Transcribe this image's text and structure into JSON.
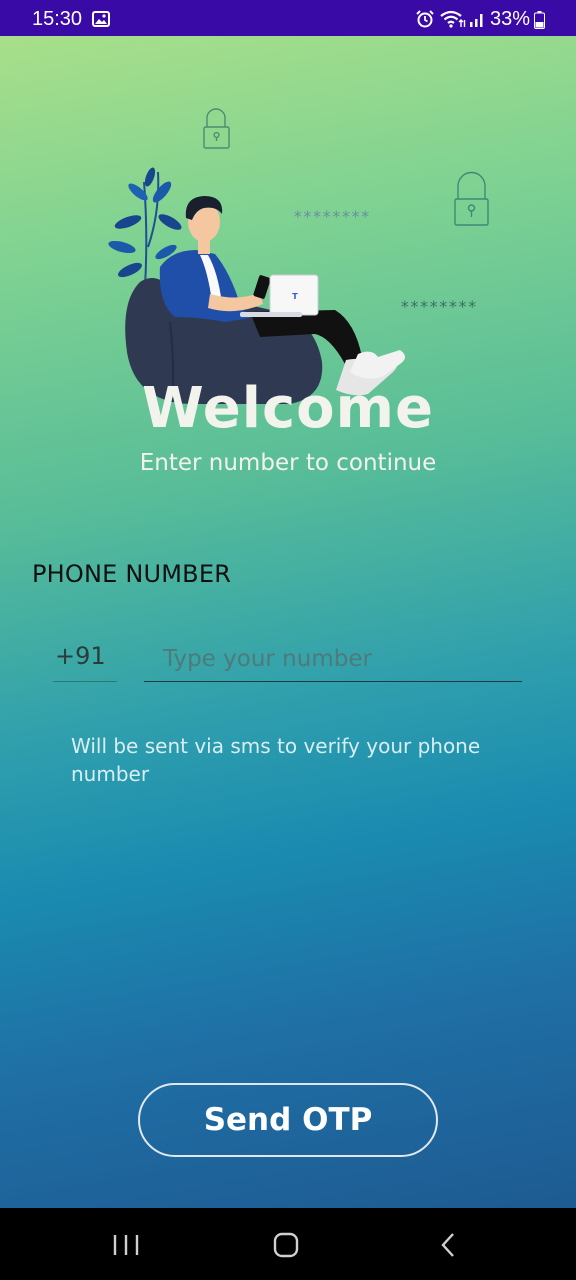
{
  "status_bar": {
    "time": "15:30",
    "battery": "33%",
    "icons": [
      "gallery-icon",
      "alarm-icon",
      "wifi-icon",
      "signal-icon",
      "battery-icon"
    ]
  },
  "illustration": {
    "password_mask_1": "********",
    "password_mask_2": "********",
    "laptop_logo": "T"
  },
  "welcome": {
    "title": "Welcome",
    "subtitle": "Enter number to continue"
  },
  "form": {
    "phone_label": "PHONE NUMBER",
    "country_code": "+91",
    "phone_value": "",
    "phone_placeholder": "Type your number",
    "helper_text": "Will be sent via sms to verify your phone number"
  },
  "actions": {
    "send_otp": "Send OTP"
  },
  "nav_bar": {
    "buttons": [
      "recent-apps-icon",
      "home-icon",
      "back-icon"
    ]
  },
  "colors": {
    "status_bar": "#3a0aa6",
    "gradient_top": "#a8df8a",
    "gradient_bottom": "#1d5b92",
    "text_light": "#f3f3ee"
  }
}
